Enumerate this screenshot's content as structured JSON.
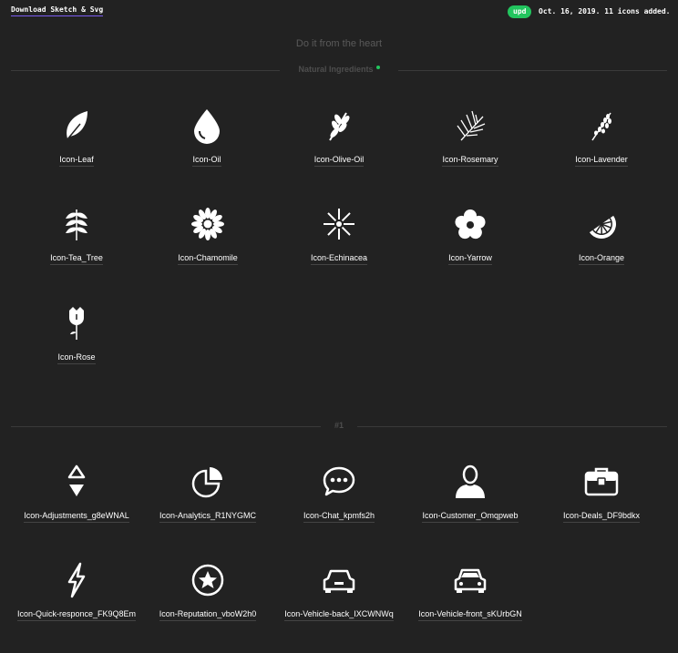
{
  "header": {
    "download_label": "Download Sketch & Svg",
    "badge": "upd",
    "update_text": "Oct. 16, 2019. 11 icons added."
  },
  "tagline": "Do it from the heart",
  "sections": [
    {
      "title": "Natural Ingredients",
      "icons": [
        {
          "label": "Icon-Leaf",
          "icon": "leaf-icon"
        },
        {
          "label": "Icon-Oil",
          "icon": "oil-drop-icon"
        },
        {
          "label": "Icon-Olive-Oil",
          "icon": "olive-branch-icon"
        },
        {
          "label": "Icon-Rosemary",
          "icon": "rosemary-icon"
        },
        {
          "label": "Icon-Lavender",
          "icon": "lavender-icon"
        },
        {
          "label": "Icon-Tea_Tree",
          "icon": "tea-tree-icon"
        },
        {
          "label": "Icon-Chamomile",
          "icon": "chamomile-icon"
        },
        {
          "label": "Icon-Echinacea",
          "icon": "echinacea-icon"
        },
        {
          "label": "Icon-Yarrow",
          "icon": "yarrow-icon"
        },
        {
          "label": "Icon-Orange",
          "icon": "orange-slice-icon"
        },
        {
          "label": "Icon-Rose",
          "icon": "rose-icon"
        }
      ]
    },
    {
      "title": "#1",
      "icons": [
        {
          "label": "Icon-Adjustments_g8eWNAL",
          "icon": "adjustments-icon"
        },
        {
          "label": "Icon-Analytics_R1NYGMC",
          "icon": "analytics-pie-icon"
        },
        {
          "label": "Icon-Chat_kpmfs2h",
          "icon": "chat-bubble-icon"
        },
        {
          "label": "Icon-Customer_Omqpweb",
          "icon": "customer-icon"
        },
        {
          "label": "Icon-Deals_DF9bdkx",
          "icon": "briefcase-icon"
        },
        {
          "label": "Icon-Quick-responce_FK9Q8Em",
          "icon": "lightning-icon"
        },
        {
          "label": "Icon-Reputation_vboW2h0",
          "icon": "star-badge-icon"
        },
        {
          "label": "Icon-Vehicle-back_IXCWNWq",
          "icon": "car-back-icon"
        },
        {
          "label": "Icon-Vehicle-front_sKUrbGN",
          "icon": "car-front-icon"
        }
      ]
    }
  ],
  "colors": {
    "background": "#222222",
    "accent_underline": "#7b5cf0",
    "badge_green": "#22c55e",
    "muted_text": "#5a5a5a"
  }
}
